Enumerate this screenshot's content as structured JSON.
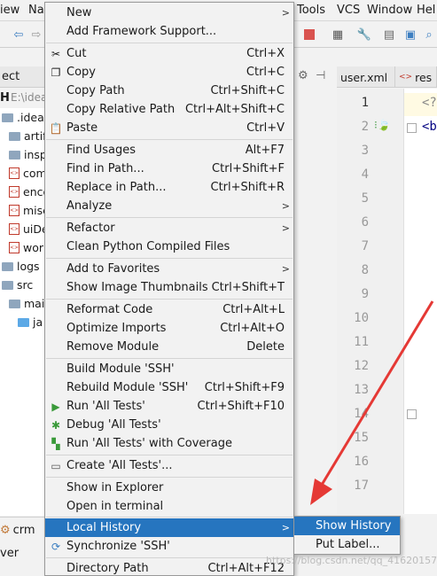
{
  "menubar": {
    "items": [
      "iew",
      "Na",
      "Tools",
      "VCS",
      "Window",
      "Hel"
    ]
  },
  "project": {
    "header": "ect",
    "path_prefix": "H",
    "path": "E:\\idea",
    "tree": [
      {
        "label": ".idea",
        "icon": "folder"
      },
      {
        "label": "artifa",
        "icon": "folder"
      },
      {
        "label": "inspe",
        "icon": "folder"
      },
      {
        "label": "com",
        "icon": "xml-file"
      },
      {
        "label": "enco",
        "icon": "xml-file"
      },
      {
        "label": "misc",
        "icon": "xml-file"
      },
      {
        "label": "uiDe",
        "icon": "xml-file"
      },
      {
        "label": "work",
        "icon": "xml-file"
      },
      {
        "label": "logs",
        "icon": "folder"
      },
      {
        "label": "src",
        "icon": "folder"
      },
      {
        "label": "mair",
        "icon": "folder"
      },
      {
        "label": "ja",
        "icon": "folder"
      }
    ]
  },
  "editor": {
    "tabs": [
      "user.xml",
      "res"
    ],
    "line_numbers": [
      "1",
      "2",
      "3",
      "4",
      "5",
      "6",
      "7",
      "8",
      "9",
      "10",
      "11",
      "12",
      "13",
      "14",
      "15",
      "16",
      "17"
    ],
    "code_line1": "<?",
    "code_line2": "<b"
  },
  "bottom": {
    "crm_tab": "crm",
    "ver_tab": "ver"
  },
  "context_menu": {
    "new": {
      "label": "New"
    },
    "add_framework": {
      "label": "Add Framework Support..."
    },
    "cut": {
      "label": "Cut",
      "shortcut": "Ctrl+X"
    },
    "copy": {
      "label": "Copy",
      "shortcut": "Ctrl+C"
    },
    "copy_path": {
      "label": "Copy Path",
      "shortcut": "Ctrl+Shift+C"
    },
    "copy_relative_path": {
      "label": "Copy Relative Path",
      "shortcut": "Ctrl+Alt+Shift+C"
    },
    "paste": {
      "label": "Paste",
      "shortcut": "Ctrl+V"
    },
    "find_usages": {
      "label": "Find Usages",
      "shortcut": "Alt+F7"
    },
    "find_in_path": {
      "label": "Find in Path...",
      "shortcut": "Ctrl+Shift+F"
    },
    "replace_in_path": {
      "label": "Replace in Path...",
      "shortcut": "Ctrl+Shift+R"
    },
    "analyze": {
      "label": "Analyze"
    },
    "refactor": {
      "label": "Refactor"
    },
    "clean_python": {
      "label": "Clean Python Compiled Files"
    },
    "add_to_favorites": {
      "label": "Add to Favorites"
    },
    "show_thumbnails": {
      "label": "Show Image Thumbnails",
      "shortcut": "Ctrl+Shift+T"
    },
    "reformat_code": {
      "label": "Reformat Code",
      "shortcut": "Ctrl+Alt+L"
    },
    "optimize_imports": {
      "label": "Optimize Imports",
      "shortcut": "Ctrl+Alt+O"
    },
    "remove_module": {
      "label": "Remove Module",
      "shortcut": "Delete"
    },
    "build_module": {
      "label": "Build Module 'SSH'"
    },
    "rebuild_module": {
      "label": "Rebuild Module 'SSH'",
      "shortcut": "Ctrl+Shift+F9"
    },
    "run_all_tests": {
      "label": "Run 'All Tests'",
      "shortcut": "Ctrl+Shift+F10"
    },
    "debug_all_tests": {
      "label": "Debug 'All Tests'"
    },
    "run_coverage": {
      "label": "Run 'All Tests' with Coverage"
    },
    "create_all_tests": {
      "label": "Create 'All Tests'..."
    },
    "show_in_explorer": {
      "label": "Show in Explorer"
    },
    "open_in_terminal": {
      "label": "Open in terminal"
    },
    "local_history": {
      "label": "Local History"
    },
    "synchronize": {
      "label": "Synchronize 'SSH'"
    },
    "directory_path": {
      "label": "Directory Path",
      "shortcut": "Ctrl+Alt+F12"
    }
  },
  "submenu": {
    "show_history": "Show History",
    "put_label": "Put Label..."
  },
  "watermark": "https://blog.csdn.net/qq_41620157",
  "colors": {
    "highlight": "#2675bf",
    "arrow": "#e53935"
  }
}
